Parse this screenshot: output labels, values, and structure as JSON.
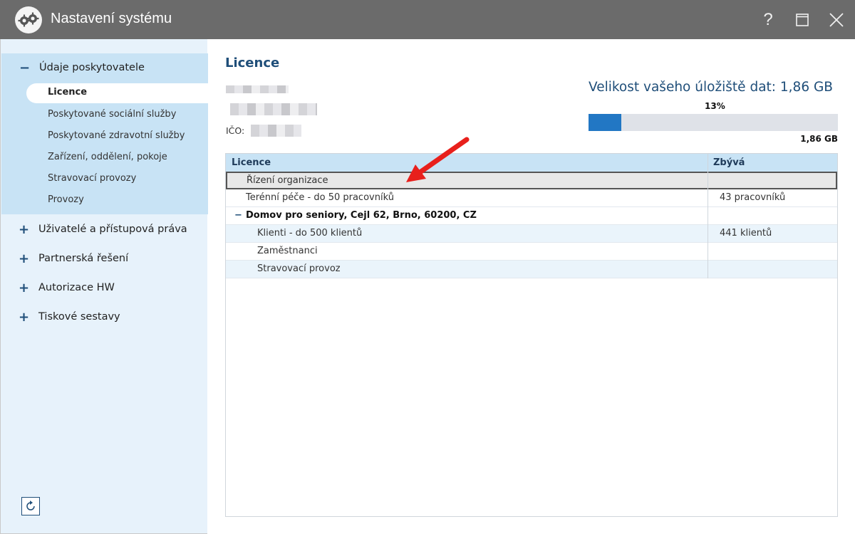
{
  "window": {
    "title": "Nastavení systému",
    "help_label": "?",
    "maximize_icon": "maximize-icon",
    "close_icon": "close-icon"
  },
  "sidebar": {
    "expanded_section": {
      "sign": "−",
      "label": "Údaje poskytovatele",
      "items": [
        {
          "label": "Licence",
          "active": true
        },
        {
          "label": "Poskytované sociální služby"
        },
        {
          "label": "Poskytované zdravotní služby"
        },
        {
          "label": "Zařízení, oddělení, pokoje"
        },
        {
          "label": "Stravovací provozy"
        },
        {
          "label": "Provozy"
        }
      ]
    },
    "sections": [
      {
        "sign": "+",
        "label": "Uživatelé a přístupová práva"
      },
      {
        "sign": "+",
        "label": "Partnerská řešení"
      },
      {
        "sign": "+",
        "label": "Autorizace HW"
      },
      {
        "sign": "+",
        "label": "Tiskové sestavy"
      }
    ],
    "refresh_icon": "refresh-icon"
  },
  "main": {
    "title": "Licence",
    "ico_label": "IČO:",
    "storage": {
      "title": "Velikost vašeho úložiště dat: 1,86 GB",
      "percent_label": "13%",
      "percent_value": 13,
      "total_label": "1,86 GB",
      "fill_color": "#2277c4"
    },
    "table": {
      "headers": [
        "Licence",
        "Zbývá"
      ],
      "rows": [
        {
          "name": "Řízení organizace",
          "remaining": "",
          "level": 1,
          "selected": true
        },
        {
          "name": "Terénní péče - do 50 pracovníků",
          "remaining": "43 pracovníků",
          "level": 1
        },
        {
          "name": "Domov pro seniory, Cejl 62, Brno, 60200, CZ",
          "remaining": "",
          "level": 0,
          "group": true,
          "sign": "−"
        },
        {
          "name": "Klienti - do 500 klientů",
          "remaining": "441 klientů",
          "level": 2
        },
        {
          "name": "Zaměstnanci",
          "remaining": "",
          "level": 2
        },
        {
          "name": "Stravovací provoz",
          "remaining": "",
          "level": 2
        }
      ]
    },
    "annotation_color": "#e8201c"
  }
}
